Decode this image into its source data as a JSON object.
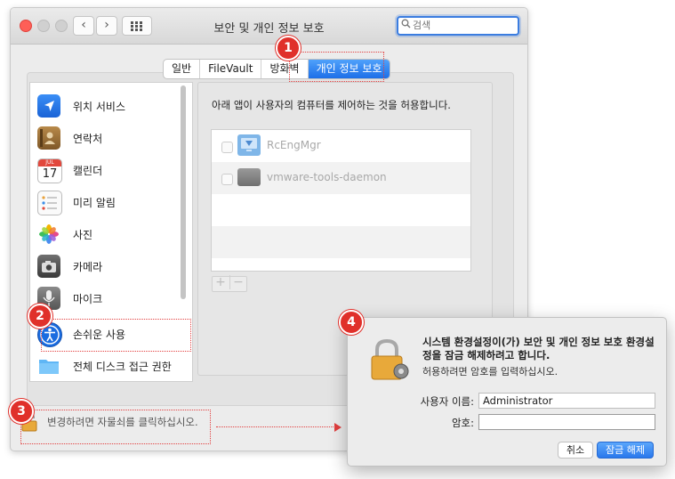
{
  "window": {
    "title": "보안 및 개인 정보 보호",
    "nav_back": "‹",
    "nav_forward": "›"
  },
  "search": {
    "placeholder": "검색",
    "icon": "magnifier-icon"
  },
  "tabs": [
    {
      "label": "일반",
      "active": false
    },
    {
      "label": "FileVault",
      "active": false
    },
    {
      "label": "방화벽",
      "active": false
    },
    {
      "label": "개인 정보 보호",
      "active": true
    }
  ],
  "sidebar": {
    "items": [
      {
        "label": "위치 서비스",
        "icon": "location-arrow-icon"
      },
      {
        "label": "연락처",
        "icon": "contacts-book-icon"
      },
      {
        "label": "캘린더",
        "icon": "calendar-icon",
        "icon_month": "JUL",
        "icon_day": "17"
      },
      {
        "label": "미리 알림",
        "icon": "reminders-icon"
      },
      {
        "label": "사진",
        "icon": "photos-icon"
      },
      {
        "label": "카메라",
        "icon": "camera-icon"
      },
      {
        "label": "마이크",
        "icon": "microphone-icon"
      },
      {
        "label": "손쉬운 사용",
        "icon": "accessibility-icon"
      },
      {
        "label": "전체 디스크 접근 권한",
        "icon": "folder-icon"
      }
    ]
  },
  "main": {
    "description": "아래 앱이 사용자의 컴퓨터를 제어하는 것을 허용합니다.",
    "apps": [
      {
        "name": "RcEngMgr",
        "checked": false,
        "icon": "remote-monitor-icon"
      },
      {
        "name": "vmware-tools-daemon",
        "checked": false,
        "icon": "generic-app-icon"
      }
    ],
    "add_label": "+",
    "remove_label": "−"
  },
  "lock": {
    "message": "변경하려면 자물쇠를 클릭하십시오.",
    "icon": "padlock-icon"
  },
  "badges": [
    "1",
    "2",
    "3",
    "4"
  ],
  "dialog": {
    "title": "시스템 환경설정이(가) 보안 및 개인 정보 보호 환경설정을 잠금 해제하려고 합니다.",
    "subtitle": "허용하려면 암호를 입력하십시오.",
    "username_label": "사용자 이름:",
    "username_value": "Administrator",
    "password_label": "암호:",
    "password_value": "",
    "cancel_label": "취소",
    "unlock_label": "잠금 해제",
    "icon": "padlock-gear-icon"
  },
  "colors": {
    "accent": "#1d6fe8",
    "annotation_red": "#e0302a",
    "window_bg": "#ececec"
  }
}
